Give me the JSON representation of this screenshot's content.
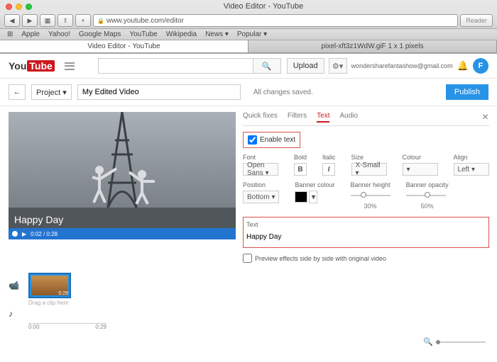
{
  "browser": {
    "window_title": "Video Editor - YouTube",
    "url": "www.youtube.com/editor",
    "reader": "Reader",
    "bookmarks": [
      "Apple",
      "Yahoo!",
      "Google Maps",
      "YouTube",
      "Wikipedia",
      "News ▾",
      "Popular ▾"
    ],
    "tabs": [
      "Video Editor - YouTube",
      "pixel-xft3z1WdW.giF 1 x 1 pixels"
    ]
  },
  "header": {
    "logo_you": "You",
    "logo_tube": "Tube",
    "search_placeholder": "",
    "upload": "Upload",
    "email": "wondersharefantashow@gmail.com",
    "avatar": "F"
  },
  "project": {
    "back": "←",
    "label": "Project ▾",
    "title": "My Edited Video",
    "status": "All changes saved.",
    "publish": "Publish"
  },
  "preview": {
    "overlay_text": "Happy Day",
    "time": "0:02 / 0:28"
  },
  "panel": {
    "tabs": [
      "Quick fixes",
      "Filters",
      "Text",
      "Audio"
    ],
    "active_tab": 2,
    "enable_text": "Enable text",
    "font_label": "Font",
    "font_value": "Open Sans ▾",
    "bold_label": "Bold",
    "italic_label": "Italic",
    "size_label": "Size",
    "size_value": "X-Small ▾",
    "colour_label": "Colour",
    "align_label": "Align",
    "align_value": "Left ▾",
    "position_label": "Position",
    "position_value": "Bottom ▾",
    "banner_colour_label": "Banner colour",
    "banner_height_label": "Banner height",
    "banner_height_value": "30%",
    "banner_opacity_label": "Banner opacity",
    "banner_opacity_value": "50%",
    "text_label": "Text",
    "text_value": "Happy Day",
    "preview_toggle": "Preview effects side by side with original video"
  },
  "timeline": {
    "clip_duration": "0:29",
    "caption": "Drag a clip here",
    "ruler_start": "0:00",
    "ruler_end": "0:29"
  }
}
